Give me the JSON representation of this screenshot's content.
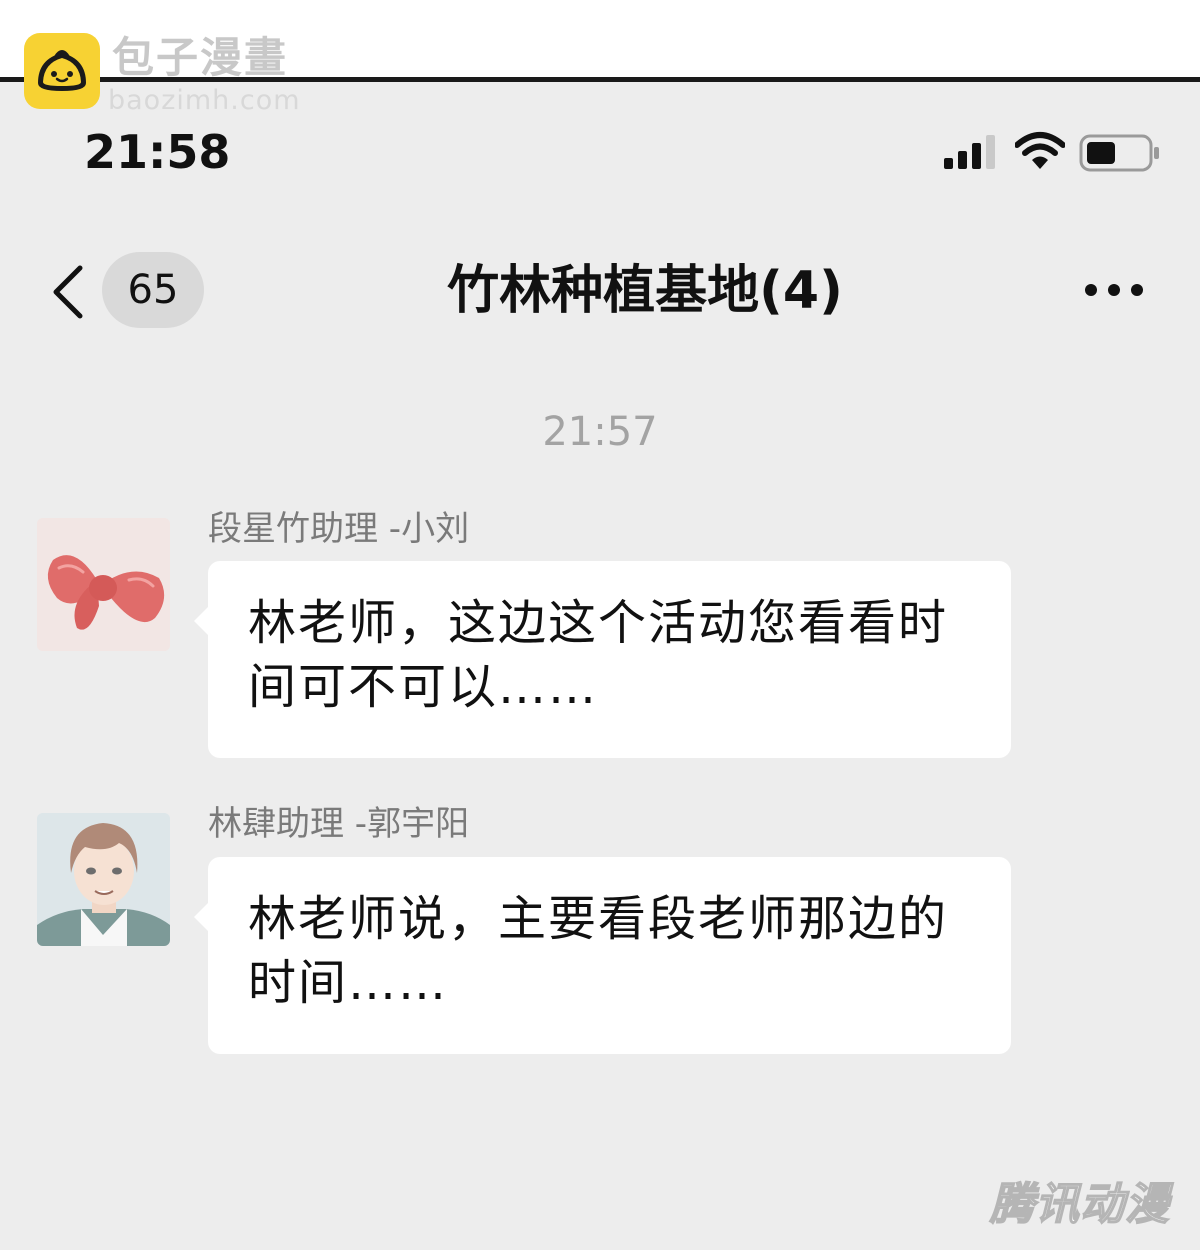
{
  "watermark": {
    "site_name": "包子漫畫",
    "site_url": "baozimh.com"
  },
  "status_bar": {
    "time": "21:58"
  },
  "nav": {
    "unread_count": "65",
    "title": "竹林种植基地(4)"
  },
  "conversation": {
    "timestamp": "21:57",
    "messages": [
      {
        "sender": "段星竹助理 -小刘",
        "text": "林老师，这边这个活动您看看时间可不可以……",
        "avatar_icon": "bow-icon"
      },
      {
        "sender": "林肆助理 -郭宇阳",
        "text": "林老师说，主要看段老师那边的时间……",
        "avatar_icon": "boy-portrait-icon"
      }
    ]
  },
  "footer": {
    "publisher_mark": "腾讯动漫"
  },
  "colors": {
    "background": "#ededed",
    "bubble": "#ffffff",
    "secondary_text": "#7a7a7a",
    "timestamp_text": "#a3a3a3",
    "logo_yellow": "#f7d233",
    "bow_red": "#e06c6a"
  }
}
